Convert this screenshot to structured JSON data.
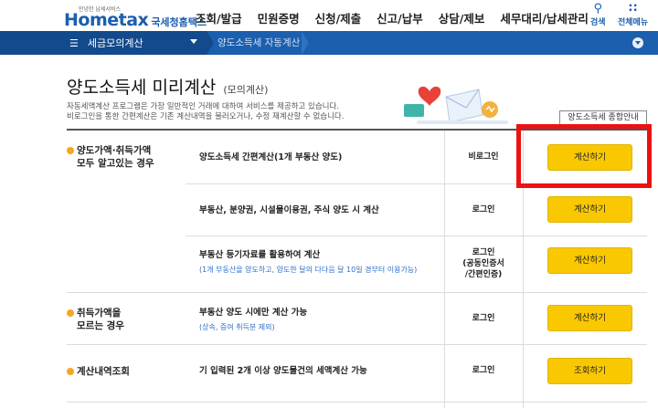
{
  "header": {
    "logo_text": "Hometax",
    "logo_tagline": "안녕한 납세서비스",
    "logo_kr": "국세청홈택스",
    "menu": [
      "조회/발급",
      "민원증명",
      "신청/제출",
      "신고/납부",
      "상담/제보",
      "세무대리/납세관리"
    ],
    "search_label": "검색",
    "all_menu_label": "전체메뉴"
  },
  "navbar": {
    "menu_label": "세금모의계산",
    "breadcrumb": "양도소득세 자동계산"
  },
  "page": {
    "title": "양도소득세 미리계산",
    "subtitle": "(모의계산)",
    "desc_line1": "자동세액계산 프로그램은 가장 일반적인 거래에 대하여 서비스를 제공하고 있습니다.",
    "desc_line2": "비로그인을 통한 간편계산은 기존 계산내역을 불러오거나, 수정 재계산할 수 없습니다.",
    "guide_button": "양도소득세 종합안내"
  },
  "sections": [
    {
      "category_line1": "양도가액·취득가액",
      "category_line2": "모두 알고있는 경우"
    },
    {
      "category_line1": "취득가액을",
      "category_line2": "모르는 경우"
    },
    {
      "category_line1": "계산내역조회",
      "category_line2": ""
    }
  ],
  "rows": [
    {
      "title": "양도소득세 간편계산(1개 부동산 양도)",
      "sub": "",
      "login": "비로그인",
      "login2": "",
      "login3": "",
      "button": "계산하기"
    },
    {
      "title": "부동산, 분양권, 시설물이용권, 주식 양도 시 계산",
      "sub": "",
      "login": "로그인",
      "login2": "",
      "login3": "",
      "button": "계산하기"
    },
    {
      "title": "부동산 등기자료를 활용하여 계산",
      "sub": "(1개 부동산을 양도하고, 양도한 달의 다다음 달 10일 경부터 이용가능)",
      "login": "로그인",
      "login2": "(공동인증서",
      "login3": "/간편인증)",
      "button": "계산하기"
    },
    {
      "title": "부동산 양도 시에만 계산 가능",
      "sub": "(상속, 증여 취득분 제외)",
      "login": "로그인",
      "login2": "",
      "login3": "",
      "button": "계산하기"
    },
    {
      "title": "기 입력된 2개 이상 양도물건의 세액계산 가능",
      "sub": "",
      "login": "로그인",
      "login2": "",
      "login3": "",
      "button": "조회하기"
    }
  ],
  "colors": {
    "brand_blue": "#1b5fae",
    "button_yellow": "#f9c800",
    "highlight_red": "#ee1111",
    "bullet_orange": "#f5a623"
  }
}
